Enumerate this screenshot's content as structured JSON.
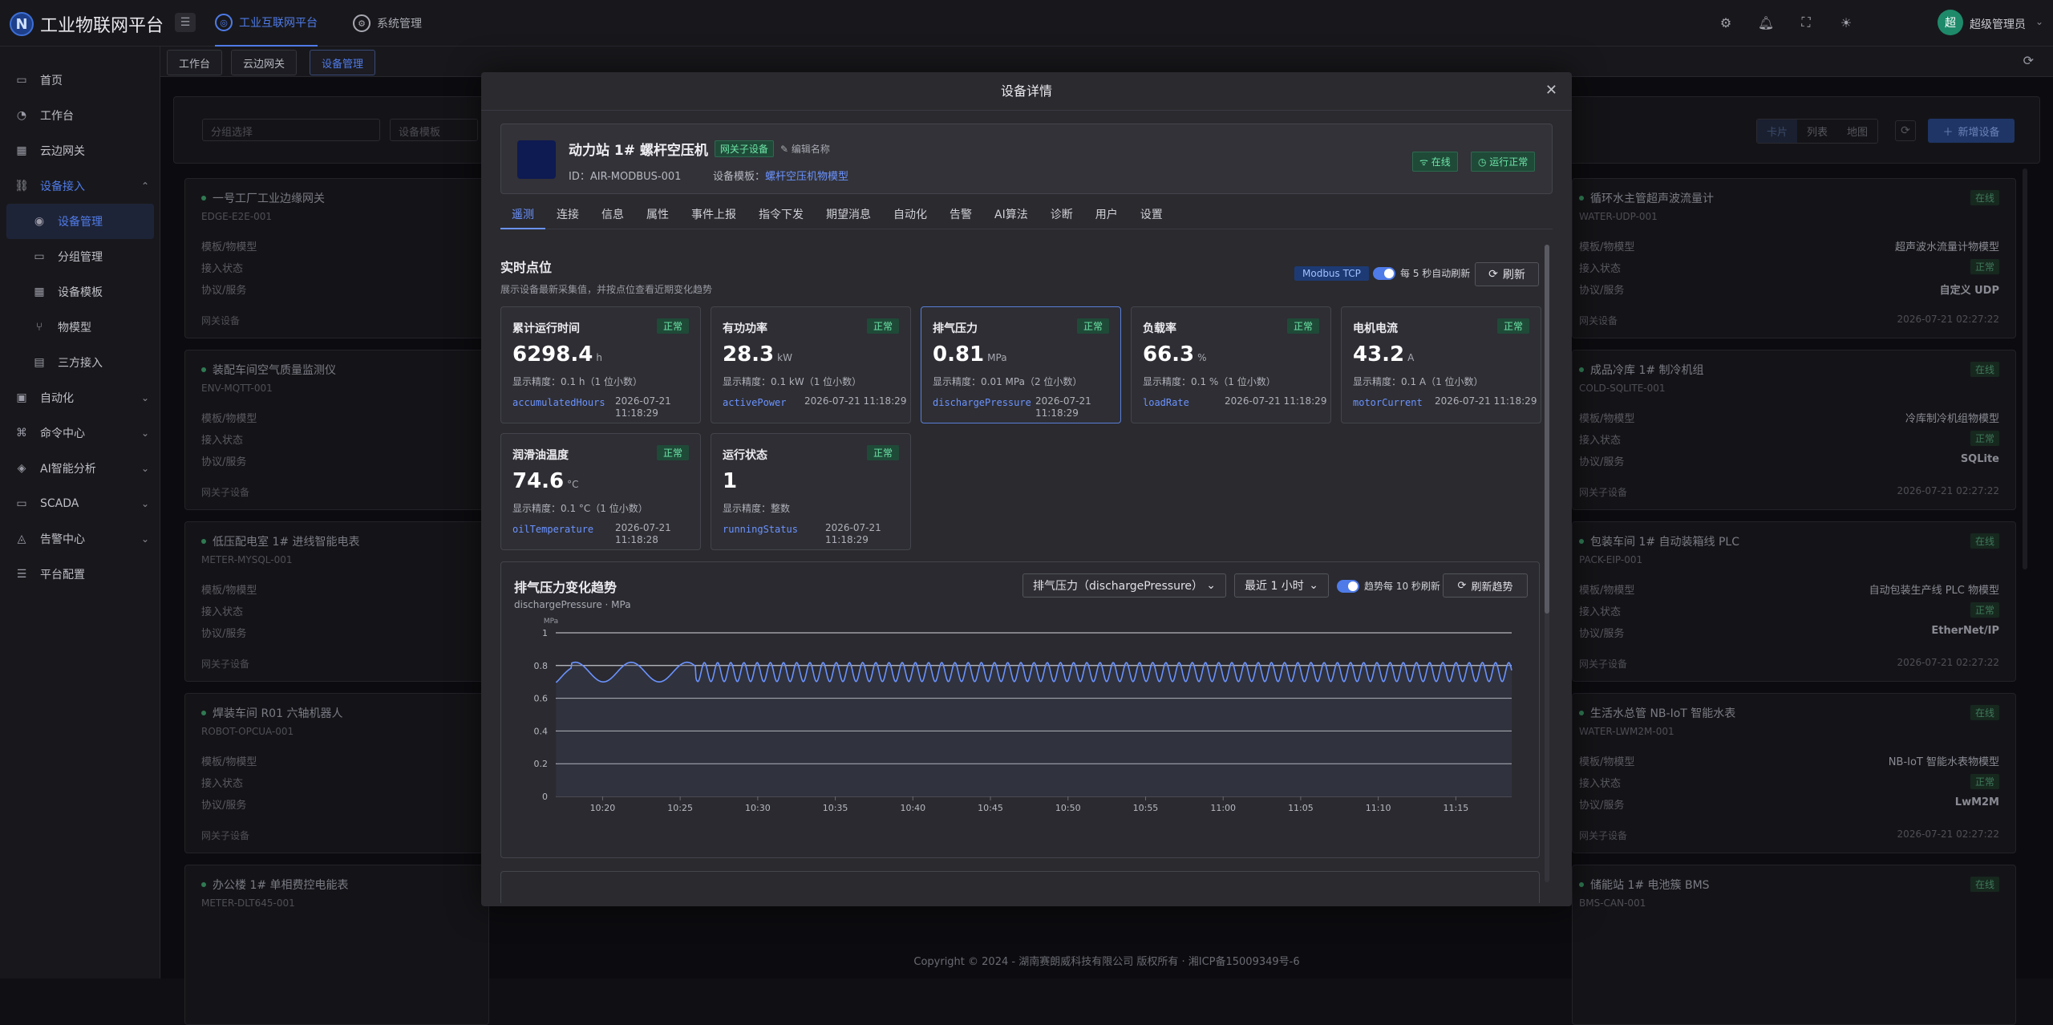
{
  "app": {
    "title": "工业物联网平台",
    "logo_letter": "N"
  },
  "topnav": [
    {
      "label": "工业互联网平台",
      "active": true
    },
    {
      "label": "系统管理",
      "active": false
    }
  ],
  "user": {
    "name": "超级管理员",
    "avatar": "超"
  },
  "sidebar": {
    "items": [
      {
        "label": "首页",
        "icon": "monitor-icon"
      },
      {
        "label": "工作台",
        "icon": "dashboard-icon"
      },
      {
        "label": "云边网关",
        "icon": "gateway-icon"
      },
      {
        "label": "设备接入",
        "icon": "link-icon",
        "open": true
      },
      {
        "label": "设备管理",
        "icon": "device-icon",
        "sub": true,
        "active": true
      },
      {
        "label": "分组管理",
        "icon": "folder-icon",
        "sub": true
      },
      {
        "label": "设备模板",
        "icon": "grid-icon",
        "sub": true
      },
      {
        "label": "物模型",
        "icon": "branch-icon",
        "sub": true
      },
      {
        "label": "三方接入",
        "icon": "table-icon",
        "sub": true
      },
      {
        "label": "自动化",
        "icon": "automation-icon",
        "chev": true
      },
      {
        "label": "命令中心",
        "icon": "command-icon",
        "chev": true
      },
      {
        "label": "AI智能分析",
        "icon": "ai-icon",
        "chev": true
      },
      {
        "label": "SCADA",
        "icon": "scada-icon",
        "chev": true
      },
      {
        "label": "告警中心",
        "icon": "alarm-icon",
        "chev": true
      },
      {
        "label": "平台配置",
        "icon": "settings-icon"
      }
    ]
  },
  "tabs": [
    {
      "label": "工作台"
    },
    {
      "label": "云边网关"
    },
    {
      "label": "设备管理",
      "active": true
    }
  ],
  "bg": {
    "filter_group": "分组选择",
    "filter_template": "设备模板",
    "view_modes": [
      "卡片",
      "列表",
      "地图"
    ],
    "add_button": "新增设备",
    "field_labels": [
      "模板/物模型",
      "接入状态",
      "协议/服务"
    ],
    "left_cards": [
      {
        "name": "一号工厂工业边缘网关",
        "code": "EDGE-E2E-001",
        "footer": "网关设备"
      },
      {
        "name": "装配车间空气质量监测仪",
        "code": "ENV-MQTT-001",
        "footer": "网关子设备"
      },
      {
        "name": "低压配电室 1# 进线智能电表",
        "code": "METER-MYSQL-001",
        "footer": "网关子设备"
      },
      {
        "name": "焊装车间 R01 六轴机器人",
        "code": "ROBOT-OPCUA-001",
        "footer": "网关子设备"
      },
      {
        "name": "办公楼 1# 单相费控电能表",
        "code": "METER-DLT645-001",
        "footer": ""
      }
    ],
    "right_cards": [
      {
        "name": "循环水主管超声波流量计",
        "code": "WATER-UDP-001",
        "model": "超声波水流量计物模型",
        "status": "正常",
        "protocol": "自定义 UDP",
        "footer": "网关设备",
        "time": "2026-07-21 02:27:22"
      },
      {
        "name": "成品冷库 1# 制冷机组",
        "code": "COLD-SQLITE-001",
        "model": "冷库制冷机组物模型",
        "status": "正常",
        "protocol": "SQLite",
        "footer": "网关子设备",
        "time": "2026-07-21 02:27:22"
      },
      {
        "name": "包装车间 1# 自动装箱线 PLC",
        "code": "PACK-EIP-001",
        "model": "自动包装生产线 PLC 物模型",
        "status": "正常",
        "protocol": "EtherNet/IP",
        "footer": "网关子设备",
        "time": "2026-07-21 02:27:22"
      },
      {
        "name": "生活水总管 NB-IoT 智能水表",
        "code": "WATER-LWM2M-001",
        "model": "NB-IoT 智能水表物模型",
        "status": "正常",
        "protocol": "LwM2M",
        "footer": "网关子设备",
        "time": "2026-07-21 02:27:22"
      },
      {
        "name": "储能站 1# 电池簇 BMS",
        "code": "BMS-CAN-001",
        "model": "",
        "status": "",
        "protocol": "",
        "footer": "",
        "time": ""
      }
    ],
    "card_badge": "在线"
  },
  "footer": "Copyright © 2024 - 湖南赛朗威科技有限公司 版权所有 · 湘ICP备15009349号-6",
  "modal": {
    "title": "设备详情",
    "device": {
      "name": "动力站 1# 螺杆空压机",
      "type_tag": "网关子设备",
      "edit_label": "编辑名称",
      "id_label": "ID：",
      "id": "AIR-MODBUS-001",
      "template_label": "设备模板：",
      "template": "螺杆空压机物模型",
      "online": "在线",
      "run_status": "运行正常"
    },
    "tabs": [
      "遥测",
      "连接",
      "信息",
      "属性",
      "事件上报",
      "指令下发",
      "期望消息",
      "自动化",
      "告警",
      "AI算法",
      "诊断",
      "用户",
      "设置"
    ],
    "realtime": {
      "title": "实时点位",
      "subtitle": "展示设备最新采集值，并按点位查看近期变化趋势",
      "protocol": "Modbus TCP",
      "auto_refresh": "每 5 秒自动刷新",
      "refresh": "刷新"
    },
    "points": [
      {
        "name": "累计运行时间",
        "status": "正常",
        "value": "6298.4",
        "unit": "h",
        "precision": "显示精度：0.1 h（1 位小数）",
        "key": "accumulatedHours",
        "time": "2026-07-21 11:18:29",
        "wrap": true
      },
      {
        "name": "有功功率",
        "status": "正常",
        "value": "28.3",
        "unit": "kW",
        "precision": "显示精度：0.1 kW（1 位小数）",
        "key": "activePower",
        "time": "2026-07-21 11:18:29",
        "wrap": false
      },
      {
        "name": "排气压力",
        "status": "正常",
        "value": "0.81",
        "unit": "MPa",
        "precision": "显示精度：0.01 MPa（2 位小数）",
        "key": "dischargePressure",
        "time": "2026-07-21 11:18:29",
        "wrap": true,
        "selected": true
      },
      {
        "name": "负载率",
        "status": "正常",
        "value": "66.3",
        "unit": "%",
        "precision": "显示精度：0.1 %（1 位小数）",
        "key": "loadRate",
        "time": "2026-07-21 11:18:29",
        "wrap": false
      },
      {
        "name": "电机电流",
        "status": "正常",
        "value": "43.2",
        "unit": "A",
        "precision": "显示精度：0.1 A（1 位小数）",
        "key": "motorCurrent",
        "time": "2026-07-21 11:18:29",
        "wrap": false
      },
      {
        "name": "润滑油温度",
        "status": "正常",
        "value": "74.6",
        "unit": "°C",
        "precision": "显示精度：0.1 °C（1 位小数）",
        "key": "oilTemperature",
        "time": "2026-07-21 11:18:28",
        "wrap": true
      },
      {
        "name": "运行状态",
        "status": "正常",
        "value": "1",
        "unit": "",
        "precision": "显示精度：整数",
        "key": "runningStatus",
        "time": "2026-07-21 11:18:29",
        "wrap": true
      }
    ],
    "trend": {
      "title": "排气压力变化趋势",
      "subtitle": "dischargePressure · MPa",
      "point_select": "排气压力（dischargePressure）",
      "range_select": "最近 1 小时",
      "auto_refresh": "趋势每 10 秒刷新",
      "refresh": "刷新趋势"
    }
  },
  "chart_data": {
    "type": "area",
    "title": "排气压力变化趋势",
    "ylabel": "MPa",
    "ylim": [
      0,
      1
    ],
    "yticks": [
      0,
      0.2,
      0.4,
      0.6,
      0.8,
      1
    ],
    "xticks": [
      "10:20",
      "10:25",
      "10:30",
      "10:35",
      "10:40",
      "10:45",
      "10:50",
      "10:55",
      "11:00",
      "11:05",
      "11:10",
      "11:15"
    ],
    "x_range_minutes": [
      10.283,
      11.31
    ],
    "series": [
      {
        "values_description_skip": null
      }
    ],
    "osc_min": 0.7,
    "osc_max": 0.82,
    "line_color": "#6b93ff",
    "fill_color": "#30323e"
  }
}
